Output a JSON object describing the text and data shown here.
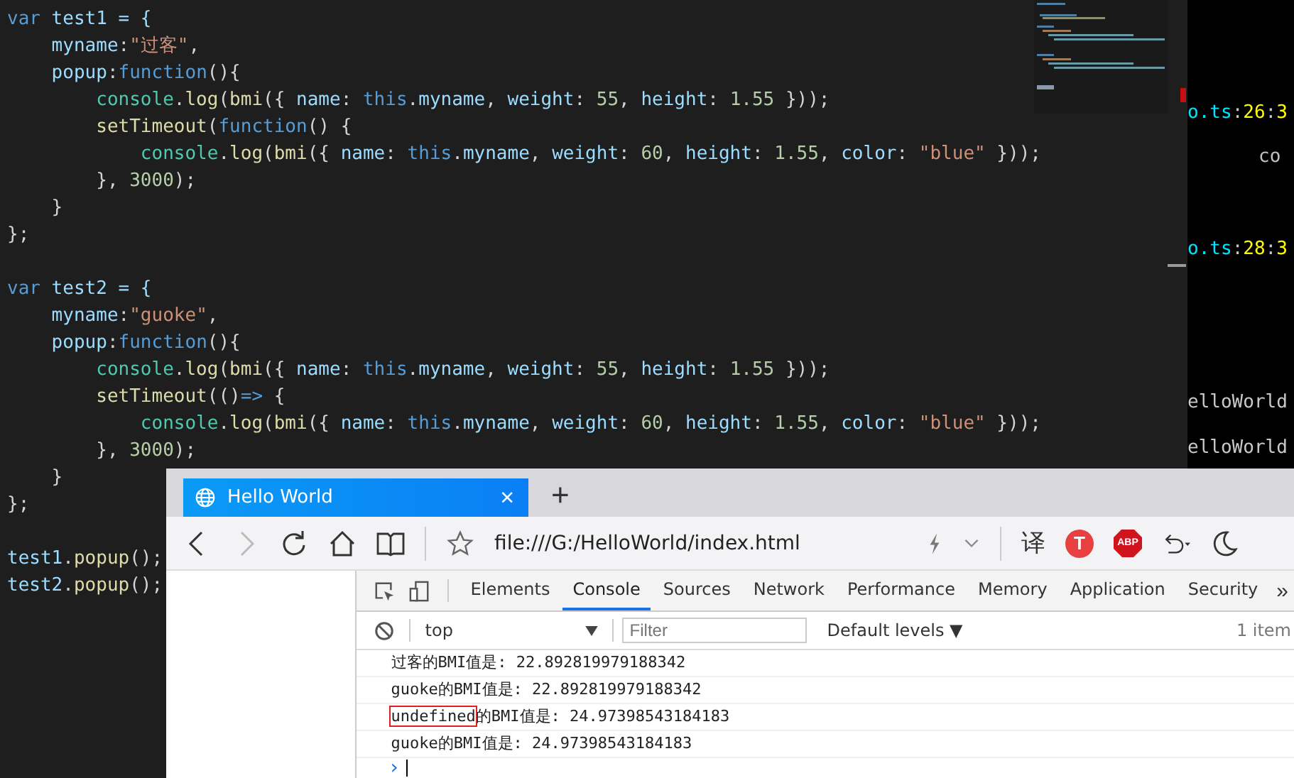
{
  "editor": {
    "lines": [
      {
        "kind": "code",
        "tokens": [
          {
            "text": "var",
            "kind": "kw"
          },
          {
            "text": " test1 = {",
            "kind": "id"
          }
        ]
      },
      {
        "kind": "code",
        "tokens": [
          {
            "text": "    myname",
            "kind": "id"
          },
          {
            "text": ":",
            "kind": "pl"
          },
          {
            "text": "\"过客\"",
            "kind": "str"
          },
          {
            "text": ",",
            "kind": "pl"
          }
        ]
      },
      {
        "kind": "code",
        "tokens": [
          {
            "text": "    popup",
            "kind": "id"
          },
          {
            "text": ":",
            "kind": "pl"
          },
          {
            "text": "function",
            "kind": "kw"
          },
          {
            "text": "(){",
            "kind": "pl"
          }
        ]
      },
      {
        "kind": "code",
        "tokens": [
          {
            "text": "        console",
            "kind": "cls"
          },
          {
            "text": ".",
            "kind": "pl"
          },
          {
            "text": "log",
            "kind": "fn"
          },
          {
            "text": "(",
            "kind": "pl"
          },
          {
            "text": "bmi",
            "kind": "fn"
          },
          {
            "text": "({ ",
            "kind": "pl"
          },
          {
            "text": "name",
            "kind": "id"
          },
          {
            "text": ": ",
            "kind": "pl"
          },
          {
            "text": "this",
            "kind": "kw"
          },
          {
            "text": ".",
            "kind": "pl"
          },
          {
            "text": "myname",
            "kind": "id"
          },
          {
            "text": ", ",
            "kind": "pl"
          },
          {
            "text": "weight",
            "kind": "id"
          },
          {
            "text": ": ",
            "kind": "pl"
          },
          {
            "text": "55",
            "kind": "num"
          },
          {
            "text": ", ",
            "kind": "pl"
          },
          {
            "text": "height",
            "kind": "id"
          },
          {
            "text": ": ",
            "kind": "pl"
          },
          {
            "text": "1.55",
            "kind": "num"
          },
          {
            "text": " }));",
            "kind": "pl"
          }
        ]
      },
      {
        "kind": "code",
        "tokens": [
          {
            "text": "        setTimeout",
            "kind": "fn"
          },
          {
            "text": "(",
            "kind": "pl"
          },
          {
            "text": "function",
            "kind": "kw"
          },
          {
            "text": "() {",
            "kind": "pl"
          }
        ]
      },
      {
        "kind": "code",
        "tokens": [
          {
            "text": "            console",
            "kind": "cls"
          },
          {
            "text": ".",
            "kind": "pl"
          },
          {
            "text": "log",
            "kind": "fn"
          },
          {
            "text": "(",
            "kind": "pl"
          },
          {
            "text": "bmi",
            "kind": "fn"
          },
          {
            "text": "({ ",
            "kind": "pl"
          },
          {
            "text": "name",
            "kind": "id"
          },
          {
            "text": ": ",
            "kind": "pl"
          },
          {
            "text": "this",
            "kind": "kw"
          },
          {
            "text": ".",
            "kind": "pl"
          },
          {
            "text": "myname",
            "kind": "id"
          },
          {
            "text": ", ",
            "kind": "pl"
          },
          {
            "text": "weight",
            "kind": "id"
          },
          {
            "text": ": ",
            "kind": "pl"
          },
          {
            "text": "60",
            "kind": "num"
          },
          {
            "text": ", ",
            "kind": "pl"
          },
          {
            "text": "height",
            "kind": "id"
          },
          {
            "text": ": ",
            "kind": "pl"
          },
          {
            "text": "1.55",
            "kind": "num"
          },
          {
            "text": ", ",
            "kind": "pl"
          },
          {
            "text": "color",
            "kind": "id"
          },
          {
            "text": ": ",
            "kind": "pl"
          },
          {
            "text": "\"blue\"",
            "kind": "str"
          },
          {
            "text": " }));",
            "kind": "pl"
          }
        ]
      },
      {
        "kind": "code",
        "tokens": [
          {
            "text": "        }, ",
            "kind": "pl"
          },
          {
            "text": "3000",
            "kind": "num"
          },
          {
            "text": ");",
            "kind": "pl"
          }
        ]
      },
      {
        "kind": "code",
        "tokens": [
          {
            "text": "    }",
            "kind": "pl"
          }
        ]
      },
      {
        "kind": "code",
        "tokens": [
          {
            "text": "};",
            "kind": "pl"
          }
        ]
      },
      {
        "kind": "blank"
      },
      {
        "kind": "code",
        "tokens": [
          {
            "text": "var",
            "kind": "kw"
          },
          {
            "text": " test2 = {",
            "kind": "id"
          }
        ]
      },
      {
        "kind": "code",
        "tokens": [
          {
            "text": "    myname",
            "kind": "id"
          },
          {
            "text": ":",
            "kind": "pl"
          },
          {
            "text": "\"guoke\"",
            "kind": "str"
          },
          {
            "text": ",",
            "kind": "pl"
          }
        ]
      },
      {
        "kind": "code",
        "tokens": [
          {
            "text": "    popup",
            "kind": "id"
          },
          {
            "text": ":",
            "kind": "pl"
          },
          {
            "text": "function",
            "kind": "kw"
          },
          {
            "text": "(){",
            "kind": "pl"
          }
        ]
      },
      {
        "kind": "code",
        "tokens": [
          {
            "text": "        console",
            "kind": "cls"
          },
          {
            "text": ".",
            "kind": "pl"
          },
          {
            "text": "log",
            "kind": "fn"
          },
          {
            "text": "(",
            "kind": "pl"
          },
          {
            "text": "bmi",
            "kind": "fn"
          },
          {
            "text": "({ ",
            "kind": "pl"
          },
          {
            "text": "name",
            "kind": "id"
          },
          {
            "text": ": ",
            "kind": "pl"
          },
          {
            "text": "this",
            "kind": "kw"
          },
          {
            "text": ".",
            "kind": "pl"
          },
          {
            "text": "myname",
            "kind": "id"
          },
          {
            "text": ", ",
            "kind": "pl"
          },
          {
            "text": "weight",
            "kind": "id"
          },
          {
            "text": ": ",
            "kind": "pl"
          },
          {
            "text": "55",
            "kind": "num"
          },
          {
            "text": ", ",
            "kind": "pl"
          },
          {
            "text": "height",
            "kind": "id"
          },
          {
            "text": ": ",
            "kind": "pl"
          },
          {
            "text": "1.55",
            "kind": "num"
          },
          {
            "text": " }));",
            "kind": "pl"
          }
        ]
      },
      {
        "kind": "code",
        "tokens": [
          {
            "text": "        setTimeout",
            "kind": "fn"
          },
          {
            "text": "(()",
            "kind": "pl"
          },
          {
            "text": "=>",
            "kind": "kw"
          },
          {
            "text": " {",
            "kind": "pl"
          }
        ]
      },
      {
        "kind": "code",
        "tokens": [
          {
            "text": "            console",
            "kind": "cls"
          },
          {
            "text": ".",
            "kind": "pl"
          },
          {
            "text": "log",
            "kind": "fn"
          },
          {
            "text": "(",
            "kind": "pl"
          },
          {
            "text": "bmi",
            "kind": "fn"
          },
          {
            "text": "({ ",
            "kind": "pl"
          },
          {
            "text": "name",
            "kind": "id"
          },
          {
            "text": ": ",
            "kind": "pl"
          },
          {
            "text": "this",
            "kind": "kw"
          },
          {
            "text": ".",
            "kind": "pl"
          },
          {
            "text": "myname",
            "kind": "id"
          },
          {
            "text": ", ",
            "kind": "pl"
          },
          {
            "text": "weight",
            "kind": "id"
          },
          {
            "text": ": ",
            "kind": "pl"
          },
          {
            "text": "60",
            "kind": "num"
          },
          {
            "text": ", ",
            "kind": "pl"
          },
          {
            "text": "height",
            "kind": "id"
          },
          {
            "text": ": ",
            "kind": "pl"
          },
          {
            "text": "1.55",
            "kind": "num"
          },
          {
            "text": ", ",
            "kind": "pl"
          },
          {
            "text": "color",
            "kind": "id"
          },
          {
            "text": ": ",
            "kind": "pl"
          },
          {
            "text": "\"blue\"",
            "kind": "str"
          },
          {
            "text": " }));",
            "kind": "pl"
          }
        ]
      },
      {
        "kind": "code",
        "tokens": [
          {
            "text": "        }, ",
            "kind": "pl"
          },
          {
            "text": "3000",
            "kind": "num"
          },
          {
            "text": ");",
            "kind": "pl"
          }
        ]
      },
      {
        "kind": "code",
        "tokens": [
          {
            "text": "    }",
            "kind": "pl"
          }
        ]
      },
      {
        "kind": "code",
        "tokens": [
          {
            "text": "};",
            "kind": "pl"
          }
        ]
      },
      {
        "kind": "blank"
      },
      {
        "kind": "code",
        "tokens": [
          {
            "text": "test1",
            "kind": "id"
          },
          {
            "text": ".",
            "kind": "pl"
          },
          {
            "text": "popup",
            "kind": "fn"
          },
          {
            "text": "();",
            "kind": "pl"
          }
        ]
      },
      {
        "kind": "code",
        "tokens": [
          {
            "text": "test2",
            "kind": "id"
          },
          {
            "text": ".",
            "kind": "pl"
          },
          {
            "text": "popup",
            "kind": "fn"
          },
          {
            "text": "();",
            "kind": "pl"
          }
        ]
      }
    ]
  },
  "terminal": {
    "lines": [
      [
        {
          "text": "o.ts",
          "kind": "file"
        },
        {
          "text": ":",
          "kind": "pl"
        },
        {
          "text": "26",
          "kind": "loc"
        },
        {
          "text": ":",
          "kind": "pl"
        },
        {
          "text": "3",
          "kind": "loc"
        }
      ],
      [
        {
          "text": "co",
          "kind": "ind"
        }
      ],
      [
        {
          "text": "o.ts",
          "kind": "file"
        },
        {
          "text": ":",
          "kind": "pl"
        },
        {
          "text": "28",
          "kind": "loc"
        },
        {
          "text": ":",
          "kind": "pl"
        },
        {
          "text": "3",
          "kind": "loc"
        }
      ],
      [
        {
          "text": "elloWorld",
          "kind": "pl"
        }
      ],
      [
        {
          "text": "elloWorld",
          "kind": "pl"
        }
      ]
    ]
  },
  "browser": {
    "tab": {
      "title": "Hello World",
      "close": "×"
    },
    "new_tab": "+",
    "url": "file:///G:/HelloWorld/index.html",
    "translate": "译",
    "ext_t": "T",
    "ext_abp": "ABP",
    "devtools": {
      "tabs": [
        {
          "label": "Elements",
          "selected": false
        },
        {
          "label": "Console",
          "selected": true
        },
        {
          "label": "Sources",
          "selected": false
        },
        {
          "label": "Network",
          "selected": false
        },
        {
          "label": "Performance",
          "selected": false
        },
        {
          "label": "Memory",
          "selected": false
        },
        {
          "label": "Application",
          "selected": false
        },
        {
          "label": "Security",
          "selected": false
        }
      ],
      "more": "»",
      "context": "top",
      "filter": {
        "placeholder": "Filter"
      },
      "levels": "Default levels ▼",
      "count": "1 item",
      "messages": [
        {
          "text": "过客的BMI值是: 22.892819979188342"
        },
        {
          "text": "guoke的BMI值是: 22.892819979188342"
        },
        {
          "boxed": "undefined",
          "text": "的BMI值是: 24.97398543184183"
        },
        {
          "text": "guoke的BMI值是: 24.97398543184183"
        }
      ],
      "prompt": "›"
    }
  }
}
